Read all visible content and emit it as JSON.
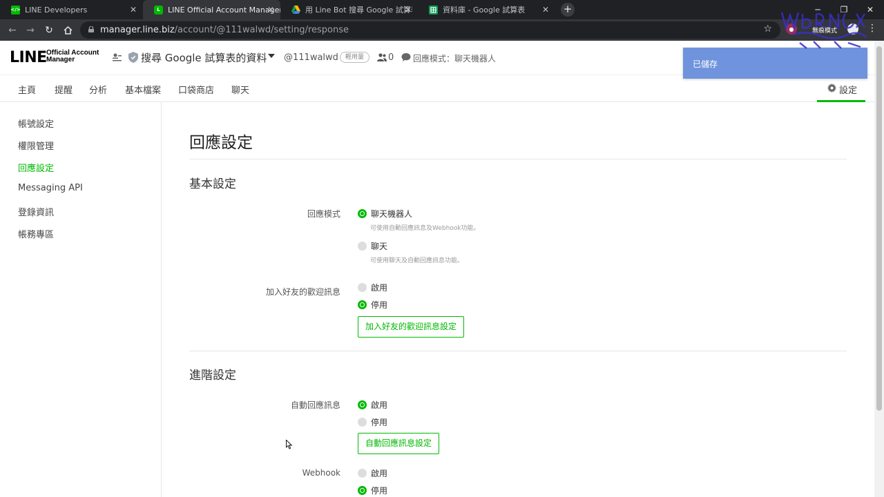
{
  "browser": {
    "tabs": [
      {
        "title": "LINE Developers",
        "favicon": "line-developers-favicon",
        "active": false
      },
      {
        "title": "LINE Official Account Manager",
        "favicon": "line-favicon",
        "active": true
      },
      {
        "title": "用 Line Bot 搜尋 Google 試算表",
        "favicon": "google-drive-favicon",
        "active": false
      },
      {
        "title": "資料庫 - Google 試算表",
        "favicon": "google-sheets-favicon",
        "active": false
      }
    ],
    "url_host": "manager.line.biz",
    "url_path": "/account/@111walwd/setting/response",
    "profile_label": "無痕模式"
  },
  "header": {
    "logo_text": "LINE",
    "logo_sub1": "Official Account",
    "logo_sub2": "Manager",
    "account_name": "搜尋 Google 試算表的資料",
    "account_id": "@111walwd",
    "plan_badge": "輕用量",
    "friend_count": "0",
    "mode_text": "回應模式：聊天機器人"
  },
  "toast": {
    "message": "已儲存"
  },
  "menu": {
    "items": [
      "主頁",
      "提醒",
      "分析",
      "基本檔案",
      "口袋商店",
      "聊天"
    ],
    "settings": "設定"
  },
  "sidebar": {
    "items": [
      "帳號設定",
      "權限管理",
      "回應設定",
      "Messaging API",
      "登錄資訊",
      "帳務專區"
    ],
    "active_index": 2
  },
  "main": {
    "title": "回應設定",
    "basic_section": "基本設定",
    "response_mode": {
      "label": "回應模式",
      "options": [
        {
          "label": "聊天機器人",
          "hint": "可使用自動回應訊息及Webhook功能。",
          "selected": true
        },
        {
          "label": "聊天",
          "hint": "可使用聊天及自動回應訊息功能。",
          "selected": false
        }
      ]
    },
    "greeting": {
      "label": "加入好友的歡迎訊息",
      "options": [
        {
          "label": "啟用",
          "selected": false
        },
        {
          "label": "停用",
          "selected": true
        }
      ],
      "button": "加入好友的歡迎訊息設定"
    },
    "advanced_section": "進階設定",
    "auto_reply": {
      "label": "自動回應訊息",
      "options": [
        {
          "label": "啟用",
          "selected": true
        },
        {
          "label": "停用",
          "selected": false
        }
      ],
      "button": "自動回應訊息設定"
    },
    "webhook": {
      "label": "Webhook",
      "options": [
        {
          "label": "啟用",
          "selected": false
        },
        {
          "label": "停用",
          "selected": true
        }
      ]
    }
  },
  "colors": {
    "accent": "#00b900",
    "toast": "#6f93dd",
    "chrome_dark": "#202124"
  }
}
